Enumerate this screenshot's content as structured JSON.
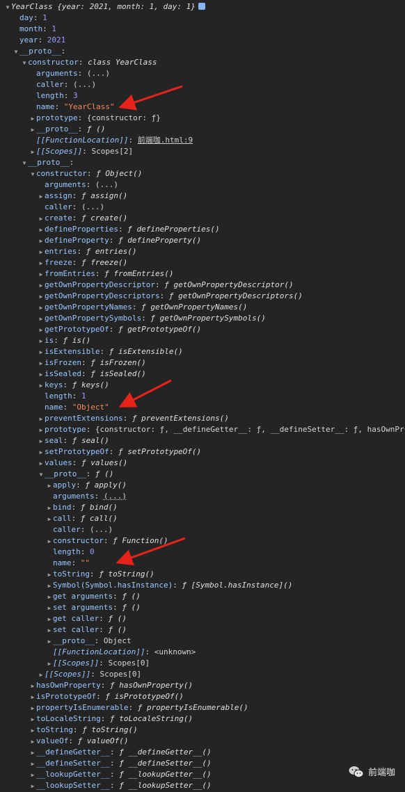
{
  "rows": [
    {
      "indent": 0,
      "tri": "down",
      "key": "YearClass",
      "key_style": "fn",
      "sep": " ",
      "value": "{year: 2021, month: 1, day: 1}",
      "value_style": "fn",
      "icon": true
    },
    {
      "indent": 1,
      "tri": "",
      "key": "day",
      "sep": ": ",
      "value": "1",
      "value_style": "num"
    },
    {
      "indent": 1,
      "tri": "",
      "key": "month",
      "sep": ": ",
      "value": "1",
      "value_style": "num"
    },
    {
      "indent": 1,
      "tri": "",
      "key": "year",
      "sep": ": ",
      "value": "2021",
      "value_style": "num"
    },
    {
      "indent": 1,
      "tri": "down",
      "key": "__proto__",
      "sep": ":",
      "value": ""
    },
    {
      "indent": 2,
      "tri": "down",
      "key": "constructor",
      "sep": ": ",
      "value": "class YearClass",
      "value_style": "fn"
    },
    {
      "indent": 3,
      "tri": "",
      "key": "arguments",
      "sep": ": ",
      "value": "(...)"
    },
    {
      "indent": 3,
      "tri": "",
      "key": "caller",
      "sep": ": ",
      "value": "(...)"
    },
    {
      "indent": 3,
      "tri": "",
      "key": "length",
      "sep": ": ",
      "value": "3",
      "value_style": "num"
    },
    {
      "indent": 3,
      "tri": "",
      "key": "name",
      "sep": ": ",
      "value": "\"YearClass\"",
      "value_style": "str"
    },
    {
      "indent": 3,
      "tri": "right",
      "key": "prototype",
      "sep": ": ",
      "value": "{constructor: ƒ}"
    },
    {
      "indent": 3,
      "tri": "right",
      "key": "__proto__",
      "sep": ": ",
      "value": "ƒ ()",
      "value_style": "fn"
    },
    {
      "indent": 3,
      "tri": "",
      "key": "[[FunctionLocation]]",
      "key_style": "it",
      "sep": ": ",
      "value": "前端咖.html:9",
      "value_style": "link"
    },
    {
      "indent": 3,
      "tri": "right",
      "key": "[[Scopes]]",
      "key_style": "it",
      "sep": ": ",
      "value": "Scopes[2]"
    },
    {
      "indent": 2,
      "tri": "down",
      "key": "__proto__",
      "sep": ":",
      "value": ""
    },
    {
      "indent": 3,
      "tri": "down",
      "key": "constructor",
      "sep": ": ",
      "value": "ƒ Object()",
      "value_style": "fn"
    },
    {
      "indent": 4,
      "tri": "",
      "key": "arguments",
      "sep": ": ",
      "value": "(...)"
    },
    {
      "indent": 4,
      "tri": "right",
      "key": "assign",
      "sep": ": ",
      "value": "ƒ assign()",
      "value_style": "fn"
    },
    {
      "indent": 4,
      "tri": "",
      "key": "caller",
      "sep": ": ",
      "value": "(...)"
    },
    {
      "indent": 4,
      "tri": "right",
      "key": "create",
      "sep": ": ",
      "value": "ƒ create()",
      "value_style": "fn"
    },
    {
      "indent": 4,
      "tri": "right",
      "key": "defineProperties",
      "sep": ": ",
      "value": "ƒ defineProperties()",
      "value_style": "fn"
    },
    {
      "indent": 4,
      "tri": "right",
      "key": "defineProperty",
      "sep": ": ",
      "value": "ƒ defineProperty()",
      "value_style": "fn"
    },
    {
      "indent": 4,
      "tri": "right",
      "key": "entries",
      "sep": ": ",
      "value": "ƒ entries()",
      "value_style": "fn"
    },
    {
      "indent": 4,
      "tri": "right",
      "key": "freeze",
      "sep": ": ",
      "value": "ƒ freeze()",
      "value_style": "fn"
    },
    {
      "indent": 4,
      "tri": "right",
      "key": "fromEntries",
      "sep": ": ",
      "value": "ƒ fromEntries()",
      "value_style": "fn"
    },
    {
      "indent": 4,
      "tri": "right",
      "key": "getOwnPropertyDescriptor",
      "sep": ": ",
      "value": "ƒ getOwnPropertyDescriptor()",
      "value_style": "fn"
    },
    {
      "indent": 4,
      "tri": "right",
      "key": "getOwnPropertyDescriptors",
      "sep": ": ",
      "value": "ƒ getOwnPropertyDescriptors()",
      "value_style": "fn"
    },
    {
      "indent": 4,
      "tri": "right",
      "key": "getOwnPropertyNames",
      "sep": ": ",
      "value": "ƒ getOwnPropertyNames()",
      "value_style": "fn"
    },
    {
      "indent": 4,
      "tri": "right",
      "key": "getOwnPropertySymbols",
      "sep": ": ",
      "value": "ƒ getOwnPropertySymbols()",
      "value_style": "fn"
    },
    {
      "indent": 4,
      "tri": "right",
      "key": "getPrototypeOf",
      "sep": ": ",
      "value": "ƒ getPrototypeOf()",
      "value_style": "fn"
    },
    {
      "indent": 4,
      "tri": "right",
      "key": "is",
      "sep": ": ",
      "value": "ƒ is()",
      "value_style": "fn"
    },
    {
      "indent": 4,
      "tri": "right",
      "key": "isExtensible",
      "sep": ": ",
      "value": "ƒ isExtensible()",
      "value_style": "fn"
    },
    {
      "indent": 4,
      "tri": "right",
      "key": "isFrozen",
      "sep": ": ",
      "value": "ƒ isFrozen()",
      "value_style": "fn"
    },
    {
      "indent": 4,
      "tri": "right",
      "key": "isSealed",
      "sep": ": ",
      "value": "ƒ isSealed()",
      "value_style": "fn"
    },
    {
      "indent": 4,
      "tri": "right",
      "key": "keys",
      "sep": ": ",
      "value": "ƒ keys()",
      "value_style": "fn"
    },
    {
      "indent": 4,
      "tri": "",
      "key": "length",
      "sep": ": ",
      "value": "1",
      "value_style": "num"
    },
    {
      "indent": 4,
      "tri": "",
      "key": "name",
      "sep": ": ",
      "value": "\"Object\"",
      "value_style": "str"
    },
    {
      "indent": 4,
      "tri": "right",
      "key": "preventExtensions",
      "sep": ": ",
      "value": "ƒ preventExtensions()",
      "value_style": "fn"
    },
    {
      "indent": 4,
      "tri": "right",
      "key": "prototype",
      "sep": ": ",
      "value": "{constructor: ƒ, __defineGetter__: ƒ, __defineSetter__: ƒ, hasOwnPr"
    },
    {
      "indent": 4,
      "tri": "right",
      "key": "seal",
      "sep": ": ",
      "value": "ƒ seal()",
      "value_style": "fn"
    },
    {
      "indent": 4,
      "tri": "right",
      "key": "setPrototypeOf",
      "sep": ": ",
      "value": "ƒ setPrototypeOf()",
      "value_style": "fn"
    },
    {
      "indent": 4,
      "tri": "right",
      "key": "values",
      "sep": ": ",
      "value": "ƒ values()",
      "value_style": "fn"
    },
    {
      "indent": 4,
      "tri": "down",
      "key": "__proto__",
      "sep": ": ",
      "value": "ƒ ()",
      "value_style": "fn"
    },
    {
      "indent": 5,
      "tri": "right",
      "key": "apply",
      "sep": ": ",
      "value": "ƒ apply()",
      "value_style": "fn"
    },
    {
      "indent": 5,
      "tri": "",
      "key": "arguments",
      "sep": ": ",
      "value": "(...)",
      "value_style": "dotted"
    },
    {
      "indent": 5,
      "tri": "right",
      "key": "bind",
      "sep": ": ",
      "value": "ƒ bind()",
      "value_style": "fn"
    },
    {
      "indent": 5,
      "tri": "right",
      "key": "call",
      "sep": ": ",
      "value": "ƒ call()",
      "value_style": "fn"
    },
    {
      "indent": 5,
      "tri": "",
      "key": "caller",
      "sep": ": ",
      "value": "(...)"
    },
    {
      "indent": 5,
      "tri": "right",
      "key": "constructor",
      "sep": ": ",
      "value": "ƒ Function()",
      "value_style": "fn"
    },
    {
      "indent": 5,
      "tri": "",
      "key": "length",
      "sep": ": ",
      "value": "0",
      "value_style": "num"
    },
    {
      "indent": 5,
      "tri": "",
      "key": "name",
      "sep": ": ",
      "value": "\"\"",
      "value_style": "str"
    },
    {
      "indent": 5,
      "tri": "right",
      "key": "toString",
      "sep": ": ",
      "value": "ƒ toString()",
      "value_style": "fn"
    },
    {
      "indent": 5,
      "tri": "right",
      "key": "Symbol(Symbol.hasInstance)",
      "sep": ": ",
      "value": "ƒ [Symbol.hasInstance]()",
      "value_style": "fn"
    },
    {
      "indent": 5,
      "tri": "right",
      "key": "get arguments",
      "sep": ": ",
      "value": "ƒ ()",
      "value_style": "fn"
    },
    {
      "indent": 5,
      "tri": "right",
      "key": "set arguments",
      "sep": ": ",
      "value": "ƒ ()",
      "value_style": "fn"
    },
    {
      "indent": 5,
      "tri": "right",
      "key": "get caller",
      "sep": ": ",
      "value": "ƒ ()",
      "value_style": "fn"
    },
    {
      "indent": 5,
      "tri": "right",
      "key": "set caller",
      "sep": ": ",
      "value": "ƒ ()",
      "value_style": "fn"
    },
    {
      "indent": 5,
      "tri": "right",
      "key": "__proto__",
      "sep": ": ",
      "value": "Object"
    },
    {
      "indent": 5,
      "tri": "",
      "key": "[[FunctionLocation]]",
      "key_style": "it",
      "sep": ": ",
      "value": "<unknown>"
    },
    {
      "indent": 5,
      "tri": "right",
      "key": "[[Scopes]]",
      "key_style": "it",
      "sep": ": ",
      "value": "Scopes[0]"
    },
    {
      "indent": 4,
      "tri": "right",
      "key": "[[Scopes]]",
      "key_style": "it",
      "sep": ": ",
      "value": "Scopes[0]"
    },
    {
      "indent": 3,
      "tri": "right",
      "key": "hasOwnProperty",
      "sep": ": ",
      "value": "ƒ hasOwnProperty()",
      "value_style": "fn"
    },
    {
      "indent": 3,
      "tri": "right",
      "key": "isPrototypeOf",
      "sep": ": ",
      "value": "ƒ isPrototypeOf()",
      "value_style": "fn"
    },
    {
      "indent": 3,
      "tri": "right",
      "key": "propertyIsEnumerable",
      "sep": ": ",
      "value": "ƒ propertyIsEnumerable()",
      "value_style": "fn"
    },
    {
      "indent": 3,
      "tri": "right",
      "key": "toLocaleString",
      "sep": ": ",
      "value": "ƒ toLocaleString()",
      "value_style": "fn"
    },
    {
      "indent": 3,
      "tri": "right",
      "key": "toString",
      "sep": ": ",
      "value": "ƒ toString()",
      "value_style": "fn"
    },
    {
      "indent": 3,
      "tri": "right",
      "key": "valueOf",
      "sep": ": ",
      "value": "ƒ valueOf()",
      "value_style": "fn"
    },
    {
      "indent": 3,
      "tri": "right",
      "key": "__defineGetter__",
      "sep": ": ",
      "value": "ƒ __defineGetter__()",
      "value_style": "fn"
    },
    {
      "indent": 3,
      "tri": "right",
      "key": "__defineSetter__",
      "sep": ": ",
      "value": "ƒ __defineSetter__()",
      "value_style": "fn"
    },
    {
      "indent": 3,
      "tri": "right",
      "key": "__lookupGetter__",
      "sep": ": ",
      "value": "ƒ __lookupGetter__()",
      "value_style": "fn"
    },
    {
      "indent": 3,
      "tri": "right",
      "key": "__lookupSetter__",
      "sep": ": ",
      "value": "ƒ __lookupSetter__()",
      "value_style": "fn"
    }
  ],
  "watermark": {
    "label": "前端咖",
    "icon": "wechat-icon"
  },
  "colors": {
    "background": "#242424",
    "key": "#9ac7ff",
    "number": "#9b9bff",
    "string": "#f28b54",
    "arrow": "#e8231b"
  }
}
